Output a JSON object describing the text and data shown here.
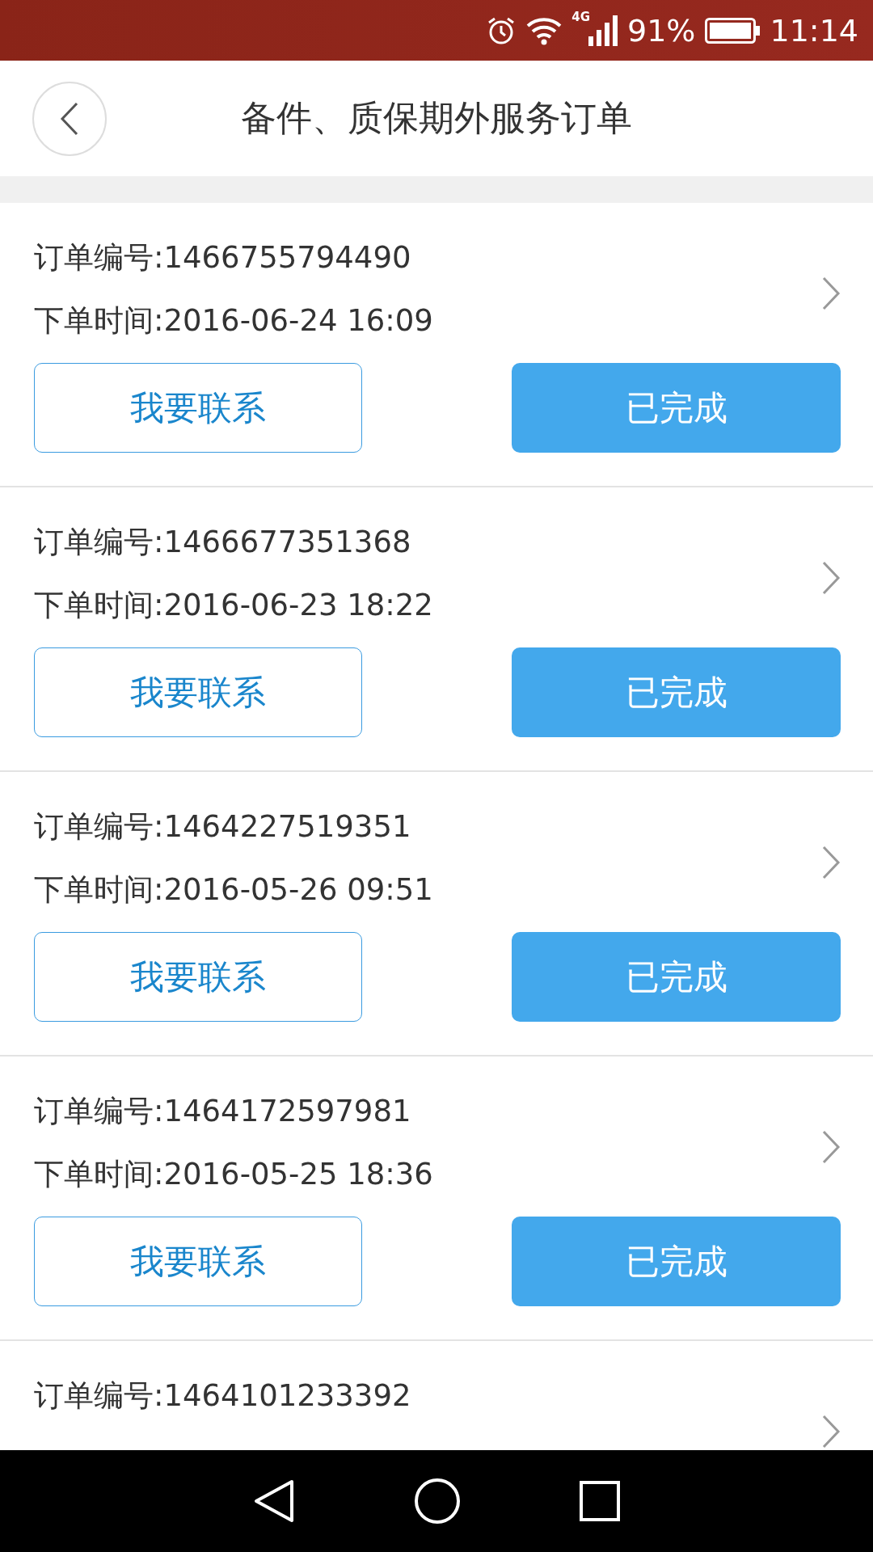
{
  "status_bar": {
    "network": "4G",
    "battery": "91%",
    "time": "11:14"
  },
  "header": {
    "title": "备件、质保期外服务订单"
  },
  "orders": [
    {
      "number": "订单编号:1466755794490",
      "time": "下单时间:2016-06-24 16:09",
      "contact_button": "我要联系",
      "status_button": "已完成"
    },
    {
      "number": "订单编号:1466677351368",
      "time": "下单时间:2016-06-23 18:22",
      "contact_button": "我要联系",
      "status_button": "已完成"
    },
    {
      "number": "订单编号:1464227519351",
      "time": "下单时间:2016-05-26 09:51",
      "contact_button": "我要联系",
      "status_button": "已完成"
    },
    {
      "number": "订单编号:1464172597981",
      "time": "下单时间:2016-05-25 18:36",
      "contact_button": "我要联系",
      "status_button": "已完成"
    },
    {
      "number": "订单编号:1464101233392"
    }
  ]
}
